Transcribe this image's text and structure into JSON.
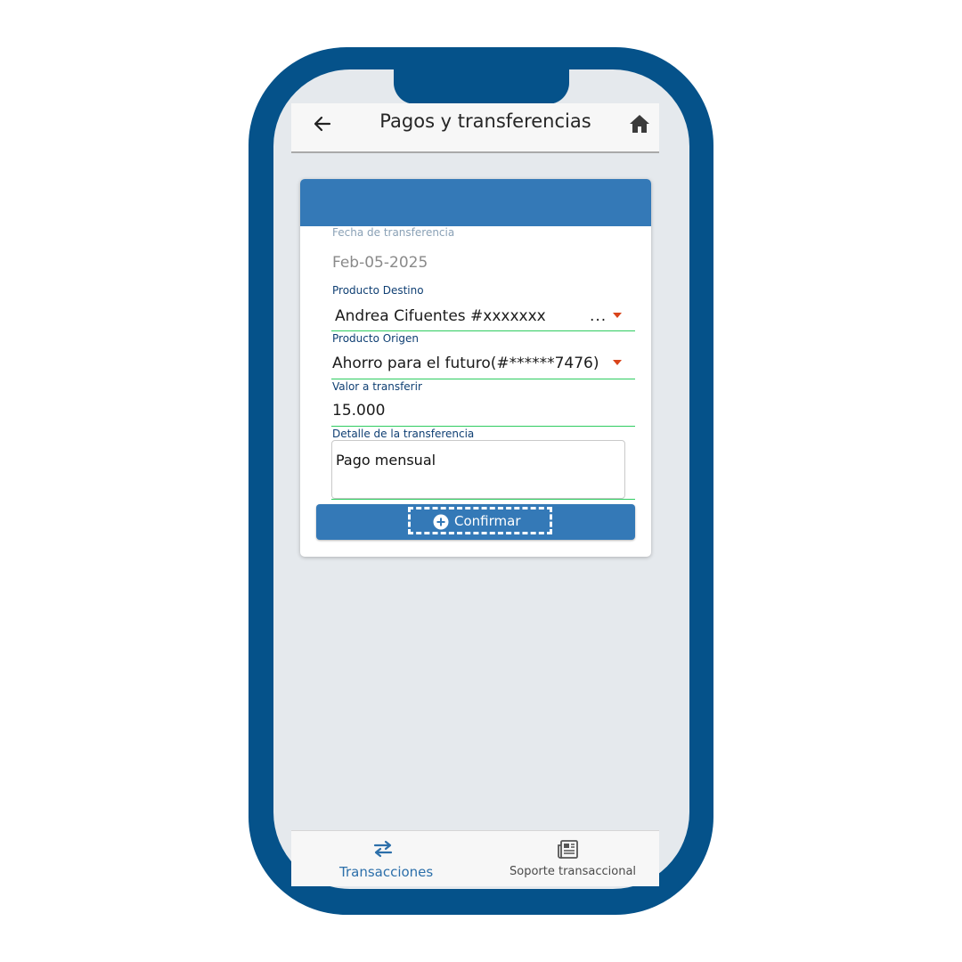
{
  "header": {
    "title": "Pagos y transferencias",
    "back_icon": "arrow-left-icon",
    "home_icon": "home-icon"
  },
  "form": {
    "fecha": {
      "label": "Fecha de transferencia",
      "value": "Feb-05-2025"
    },
    "destino": {
      "label": "Producto Destino",
      "value": "Andrea Cifuentes #xxxxxxx",
      "overflow": "..."
    },
    "origen": {
      "label": "Producto Origen",
      "value": "Ahorro para el futuro(#******7476)"
    },
    "valor": {
      "label": "Valor a transferir",
      "value": "15.000"
    },
    "detalle": {
      "label": "Detalle de la transferencia",
      "value": "Pago mensual"
    },
    "confirm_label": "Confirmar"
  },
  "bottom_nav": {
    "items": [
      {
        "label": "Transacciones",
        "icon": "transfer-arrows-icon",
        "active": true
      },
      {
        "label": "Soporte transaccional",
        "icon": "newspaper-icon",
        "active": false
      }
    ]
  },
  "colors": {
    "phone_frame": "#05528a",
    "accent": "#3479b7",
    "underline": "#2ecc60",
    "caret": "#d9441a"
  }
}
